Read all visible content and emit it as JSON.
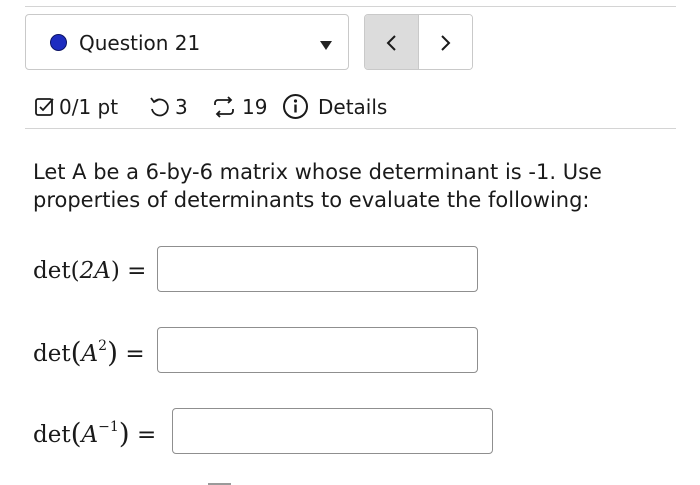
{
  "question_selector": {
    "label": "Question 21",
    "status_color": "#1d2cc0"
  },
  "nav": {
    "prev_symbol": "<",
    "next_symbol": ">"
  },
  "meta": {
    "score": "0/1 pt",
    "attempts": "3",
    "versions": "19",
    "details": "Details"
  },
  "question": {
    "text": "Let A be a 6-by-6 matrix whose determinant is -1. Use properties of determinants to evaluate the following:"
  },
  "parts": [
    {
      "expr_fn": "det",
      "expr_arg": "2A",
      "equals": "=",
      "value": ""
    },
    {
      "expr_fn": "det",
      "expr_base": "A",
      "expr_exp": "2",
      "equals": "=",
      "value": ""
    },
    {
      "expr_fn": "det",
      "expr_base": "A",
      "expr_exp": "−1",
      "equals": "=",
      "value": ""
    }
  ]
}
